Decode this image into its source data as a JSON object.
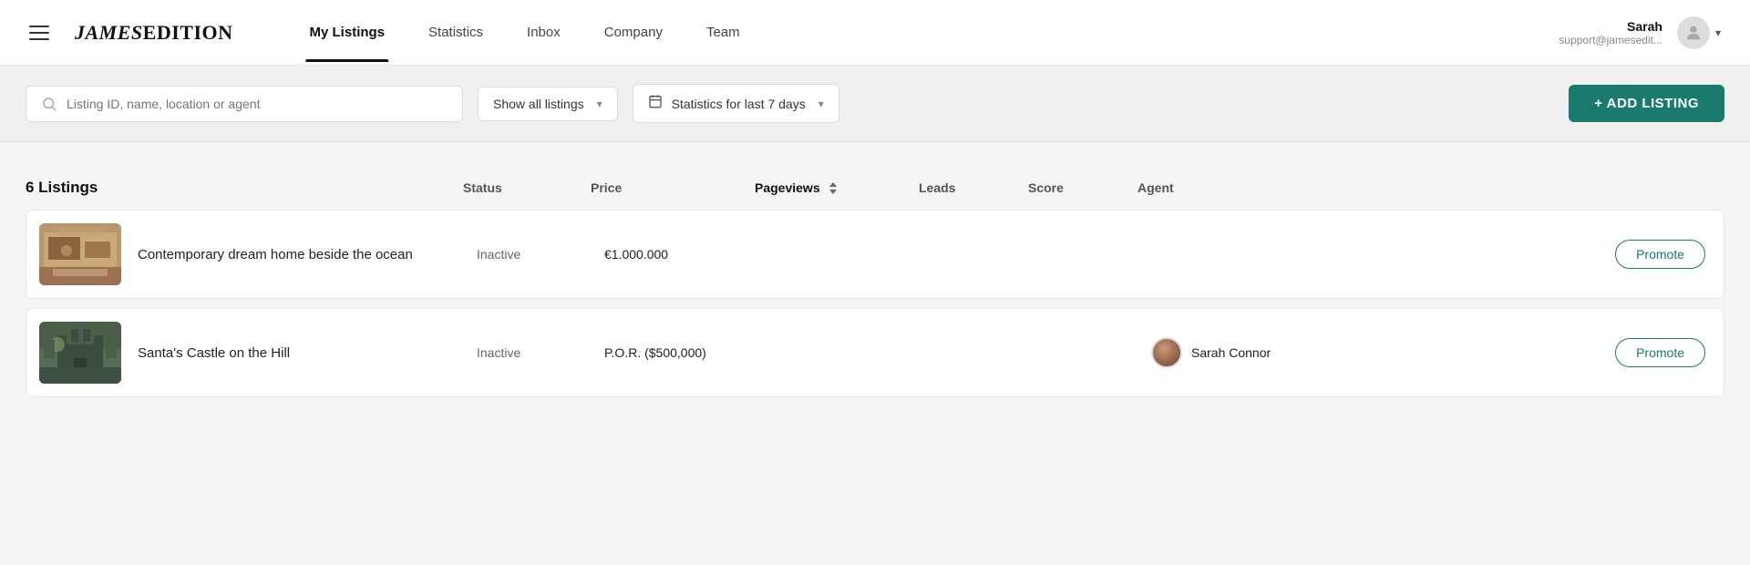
{
  "header": {
    "logo": "JamesEdition",
    "nav_items": [
      {
        "label": "My Listings",
        "active": true
      },
      {
        "label": "Statistics",
        "active": false
      },
      {
        "label": "Inbox",
        "active": false
      },
      {
        "label": "Company",
        "active": false
      },
      {
        "label": "Team",
        "active": false
      }
    ],
    "user": {
      "name": "Sarah",
      "email": "support@jamesedit...",
      "avatar_label": "user avatar"
    }
  },
  "toolbar": {
    "search_placeholder": "Listing ID, name, location or agent",
    "show_listings_label": "Show all listings",
    "statistics_label": "Statistics for last 7 days",
    "add_listing_label": "+ ADD LISTING"
  },
  "table": {
    "count_label": "6 Listings",
    "columns": {
      "status": "Status",
      "price": "Price",
      "pageviews": "Pageviews",
      "leads": "Leads",
      "score": "Score",
      "agent": "Agent"
    },
    "rows": [
      {
        "name": "Contemporary dream home beside the ocean",
        "status": "Inactive",
        "price": "€1.000.000",
        "pageviews": "",
        "leads": "",
        "score": "",
        "agent_name": "",
        "has_agent": false,
        "promote_label": "Promote"
      },
      {
        "name": "Santa's Castle on the Hill",
        "status": "Inactive",
        "price": "P.O.R. ($500,000)",
        "pageviews": "",
        "leads": "",
        "score": "",
        "agent_name": "Sarah Connor",
        "has_agent": true,
        "promote_label": "Promote"
      }
    ]
  },
  "icons": {
    "hamburger": "☰",
    "search": "⊘",
    "calendar": "📅",
    "chevron_down": "▾",
    "sort": "sort",
    "user": "user"
  }
}
